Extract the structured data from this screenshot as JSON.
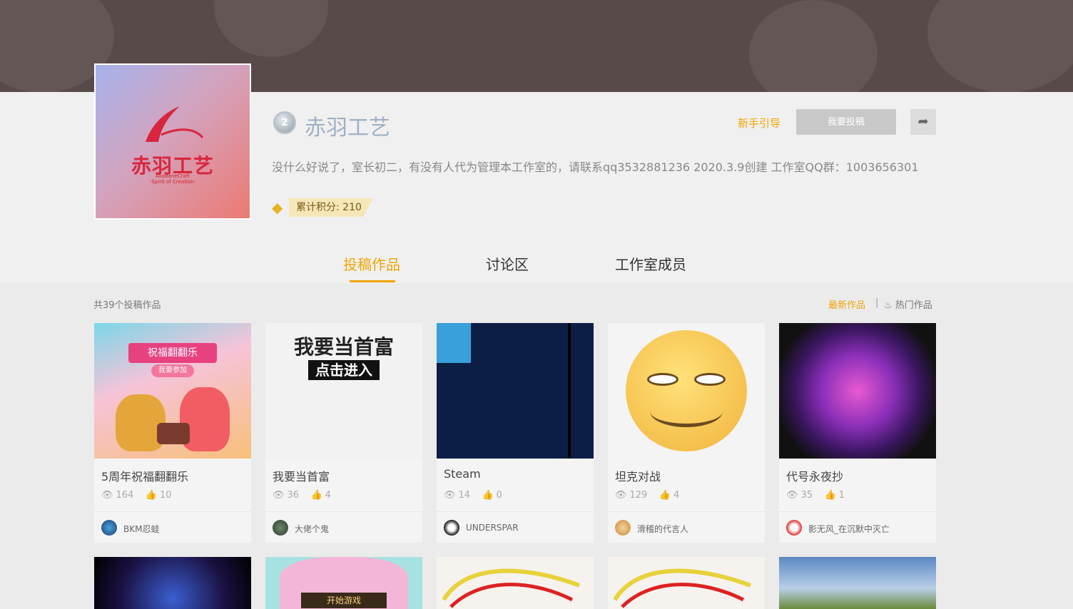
{
  "studio": {
    "name": "赤羽工艺",
    "level": "2",
    "logo_text": "赤羽工艺",
    "logo_sub": "AkabaneCraft",
    "logo_sub2": "-Spirit of Creation-",
    "description": "没什么好说了，室长初二，有没有人代为管理本工作室的，请联系qq3532881236 2020.3.9创建 工作室QQ群：1003656301",
    "score_label": "累计积分: 210"
  },
  "header_actions": {
    "guide": "新手引导",
    "submit": "我要投稿"
  },
  "tabs": [
    {
      "label": "投稿作品",
      "active": true
    },
    {
      "label": "讨论区",
      "active": false
    },
    {
      "label": "工作室成员",
      "active": false
    }
  ],
  "works": {
    "count_text": "共39个投稿作品",
    "sort_new": "最新作品",
    "sort_sep": "|",
    "sort_hot": "热门作品",
    "items": [
      {
        "title": "5周年祝福翻翻乐",
        "views": "164",
        "likes": "10",
        "author": "BKM忍蛙",
        "thumb_text": "祝福翻翻乐",
        "thumb_sub": "我要参加"
      },
      {
        "title": "我要当首富",
        "views": "36",
        "likes": "4",
        "author": "大佬个鬼",
        "thumb_text": "我要当首富",
        "thumb_sub": "点击进入"
      },
      {
        "title": "Steam",
        "views": "14",
        "likes": "0",
        "author": "UNDERSPAR",
        "thumb_text": "",
        "thumb_sub": ""
      },
      {
        "title": "坦克对战",
        "views": "129",
        "likes": "4",
        "author": "滑稽的代言人",
        "thumb_text": "",
        "thumb_sub": ""
      },
      {
        "title": "代号永夜抄",
        "views": "35",
        "likes": "1",
        "author": "影无风_在沉默中灭亡",
        "thumb_text": "",
        "thumb_sub": ""
      }
    ],
    "row2_thumb_text": "开始游戏"
  },
  "colors": {
    "accent": "#f0a500",
    "banner": "#574a48"
  }
}
